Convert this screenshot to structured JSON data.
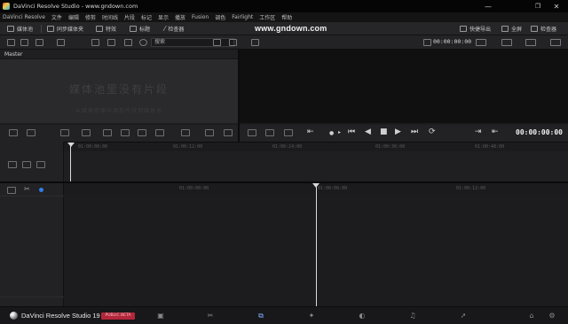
{
  "window": {
    "title": "DaVinci Resolve Studio - www.gndown.com",
    "minimize": "—",
    "maximize": "❐",
    "close": "✕"
  },
  "menu": [
    "DaVinci Resolve",
    "文件",
    "编辑",
    "修剪",
    "时间线",
    "片段",
    "标记",
    "显示",
    "播放",
    "Fusion",
    "调色",
    "Fairlight",
    "工作区",
    "帮助"
  ],
  "toolbar": {
    "media_pool": "媒体池",
    "sync_bin": "同步媒体夹",
    "effects": "特效",
    "titles": "标题",
    "inspector_fx": "检查器",
    "quick_export": "快捷导出",
    "fullscreen": "全屏",
    "inspector": "检查器"
  },
  "watermark": "www.gndown.com",
  "search": {
    "placeholder": "搜索"
  },
  "source_timecode": "00:00:00:00",
  "media_pool_panel": {
    "bin": "Master",
    "empty_title": "媒体池里没有片段",
    "empty_hint": "从媒体存储中添加片段到媒体池"
  },
  "viewer": {
    "timecode": "00:00:00:00"
  },
  "upper_ruler": [
    "01:00:00:00",
    "01:00:12:00",
    "01:00:24:00",
    "01:00:36:00",
    "01:00:48:00"
  ],
  "lower_ruler": [
    "01:00:00:00",
    "01:00:06:00",
    "01:00:12:00"
  ],
  "footer": {
    "brand": "DaVinci Resolve Studio 19",
    "beta": "PUBLIC BETA"
  },
  "pages": [
    {
      "name": "media",
      "icon": "▣"
    },
    {
      "name": "cut",
      "icon": "✂"
    },
    {
      "name": "edit",
      "icon": "⧉"
    },
    {
      "name": "fusion",
      "icon": "✦"
    },
    {
      "name": "color",
      "icon": "◐"
    },
    {
      "name": "fairlight",
      "icon": "♫"
    },
    {
      "name": "deliver",
      "icon": "➚"
    }
  ],
  "colors": {
    "accent": "#7fb0ff",
    "beta_badge": "#b3263a",
    "playhead": "#d9d9d9"
  }
}
